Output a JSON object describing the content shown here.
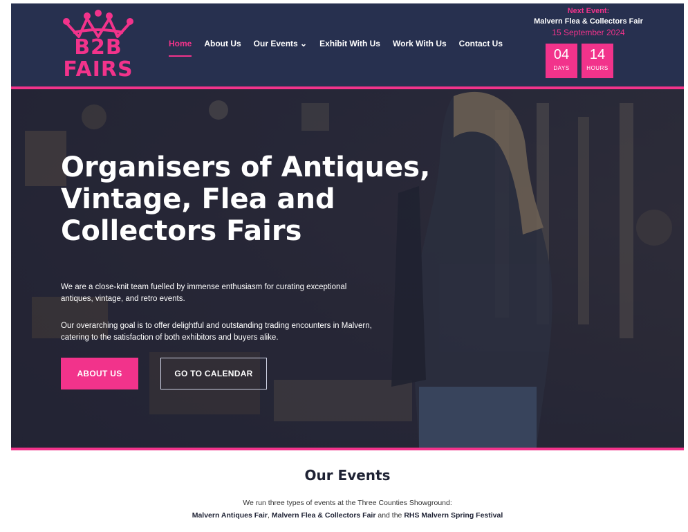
{
  "header": {
    "logo": {
      "line1": "B2B",
      "line2": "FAIRS"
    },
    "nav": [
      {
        "label": "Home",
        "active": true
      },
      {
        "label": "About Us"
      },
      {
        "label": "Our Events ⌄"
      },
      {
        "label": "Exhibit With Us"
      },
      {
        "label": "Work With Us"
      },
      {
        "label": "Contact Us"
      }
    ],
    "next_event": {
      "label": "Next Event:",
      "name": "Malvern Flea & Collectors Fair",
      "date": "15 September 2024",
      "days_value": "04",
      "days_unit": "DAYS",
      "hours_value": "14",
      "hours_unit": "HOURS"
    }
  },
  "hero": {
    "title": "Organisers of Antiques, Vintage, Flea and Collectors Fairs",
    "para1": "We are a close-knit team fuelled by immense enthusiasm for curating exceptional antiques, vintage, and retro events.",
    "para2": "Our overarching goal is to offer delightful and outstanding trading encounters in Malvern, catering to the satisfaction of both exhibitors and buyers alike.",
    "btn_about": "ABOUT US",
    "btn_calendar": "GO TO CALENDAR"
  },
  "events": {
    "heading": "Our Events",
    "intro": "We run three types of events at the Three Counties Showground:",
    "event1": "Malvern Antiques Fair",
    "sep1": ", ",
    "event2": "Malvern Flea & Collectors Fair",
    "sep2": " and the ",
    "event3": "RHS Malvern Spring Festival"
  },
  "colors": {
    "brand_pink": "#f2338b",
    "header_navy": "#27304f"
  }
}
